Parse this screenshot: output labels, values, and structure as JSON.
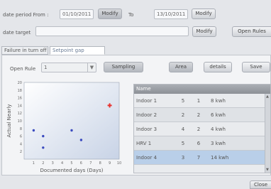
{
  "header": {
    "date_label": "date period From :",
    "from_value": "01/10/2011",
    "to_label": "To",
    "to_value": "13/10/2011",
    "modify_label": "Modify",
    "target_label": "date target",
    "target_value": "",
    "open_rules_label": "Open Rules"
  },
  "tabs": [
    {
      "label": "Failure in turn off"
    },
    {
      "label": "Setpoint gap"
    }
  ],
  "toolbar": {
    "open_rule_label": "Open Rule",
    "open_rule_value": "1",
    "sampling_label": "Sampling",
    "area_label": "Area",
    "details_label": "details",
    "save_label": "Save"
  },
  "chart_data": {
    "type": "scatter",
    "xlabel": "Documented days (Days)",
    "ylabel": "Actual Nearly",
    "xlim": [
      0,
      10
    ],
    "ylim": [
      0,
      20
    ],
    "x_ticks": [
      "1",
      "2",
      "3",
      "4",
      "5",
      "6",
      "7",
      "8",
      "9",
      "10"
    ],
    "y_ticks": [
      "2",
      "4",
      "6",
      "8",
      "10",
      "12",
      "14",
      "16",
      "18",
      "20"
    ],
    "grid": false,
    "series": [
      {
        "color": "#3b4bbf",
        "points": [
          [
            1,
            7.5
          ],
          [
            2,
            6
          ],
          [
            2,
            3
          ],
          [
            5,
            7.5
          ],
          [
            6,
            5
          ]
        ]
      },
      {
        "color": "#e8312e",
        "points": [
          [
            9,
            14
          ]
        ]
      }
    ]
  },
  "table": {
    "header": "Name",
    "rows": [
      {
        "name": "Indoor 1",
        "a": "5",
        "b": "1",
        "c": "8 kwh"
      },
      {
        "name": "Indoor 2",
        "a": "2",
        "b": "2",
        "c": "6 kwh"
      },
      {
        "name": "Indoor 3",
        "a": "4",
        "b": "2",
        "c": "4 kwh"
      },
      {
        "name": "HRV 1",
        "a": "5",
        "b": "6",
        "c": "3 kwh"
      },
      {
        "name": "Indoor 4",
        "a": "3",
        "b": "7",
        "c": "14 kwh"
      }
    ]
  },
  "footer": {
    "close_label": "Close"
  }
}
